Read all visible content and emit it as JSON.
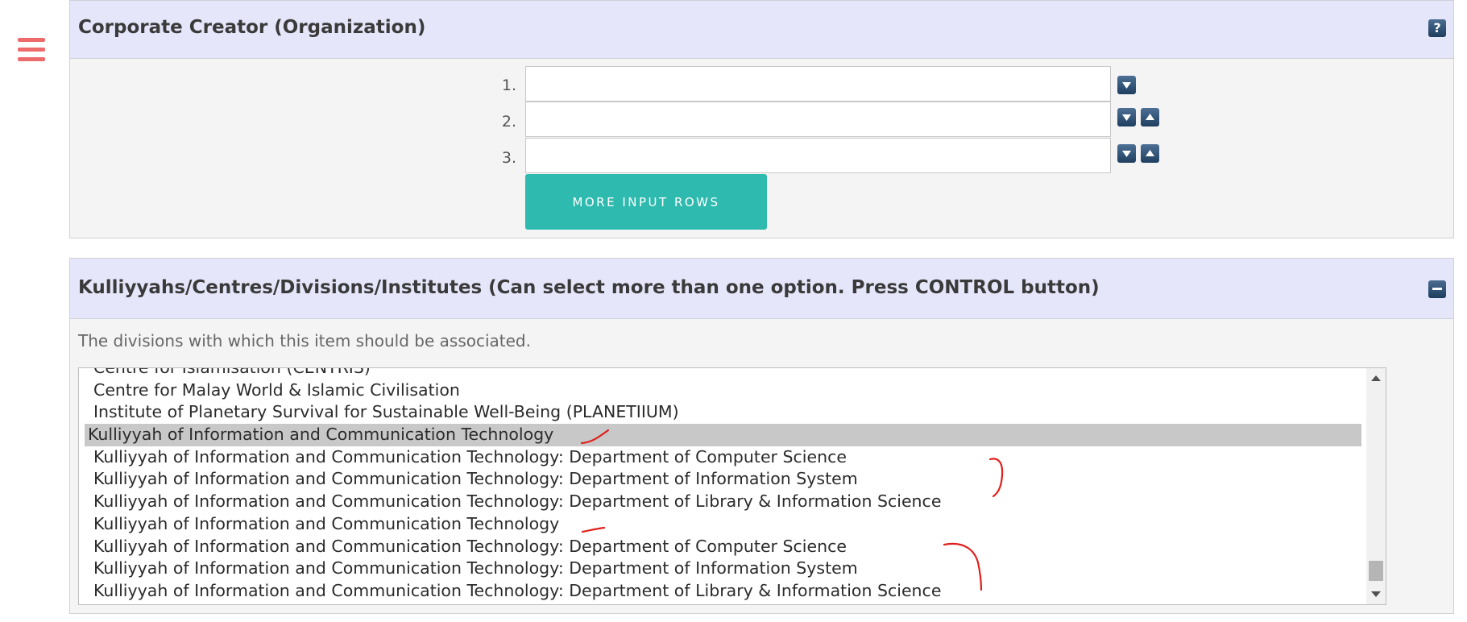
{
  "menu": {
    "icon": "hamburger-menu-icon"
  },
  "corporate_creator": {
    "title": "Corporate Creator (Organization)",
    "help_icon": "?",
    "rows": [
      {
        "num": "1.",
        "value": ""
      },
      {
        "num": "2.",
        "value": ""
      },
      {
        "num": "3.",
        "value": ""
      }
    ],
    "more_rows_label": "MORE INPUT ROWS"
  },
  "divisions": {
    "title": "Kulliyyahs/Centres/Divisions/Institutes (Can select more than one option. Press CONTROL button)",
    "help_text": "The divisions with which this item should be associated.",
    "options": [
      "Centre for Islamisation (CENTRIS)",
      "Centre for Malay World & Islamic Civilisation",
      "Institute of Planetary Survival for Sustainable Well-Being (PLANETIIUM)",
      "Kulliyyah of Information and Communication Technology",
      "Kulliyyah of Information and Communication Technology: Department of Computer Science",
      "Kulliyyah of Information and Communication Technology: Department of Information System",
      "Kulliyyah of Information and Communication Technology: Department of Library & Information Science",
      "Kulliyyah of Information and Communication Technology",
      "Kulliyyah of Information and Communication Technology: Department of Computer Science",
      "Kulliyyah of Information and Communication Technology: Department of Information System",
      "Kulliyyah of Information and Communication Technology: Department of Library & Information Science"
    ],
    "selected_index": 3
  },
  "colors": {
    "header_bg": "#e6e6fb",
    "accent_button": "#2ebaae",
    "hamburger": "#ee6b6b",
    "annotation": "#e0201c"
  }
}
